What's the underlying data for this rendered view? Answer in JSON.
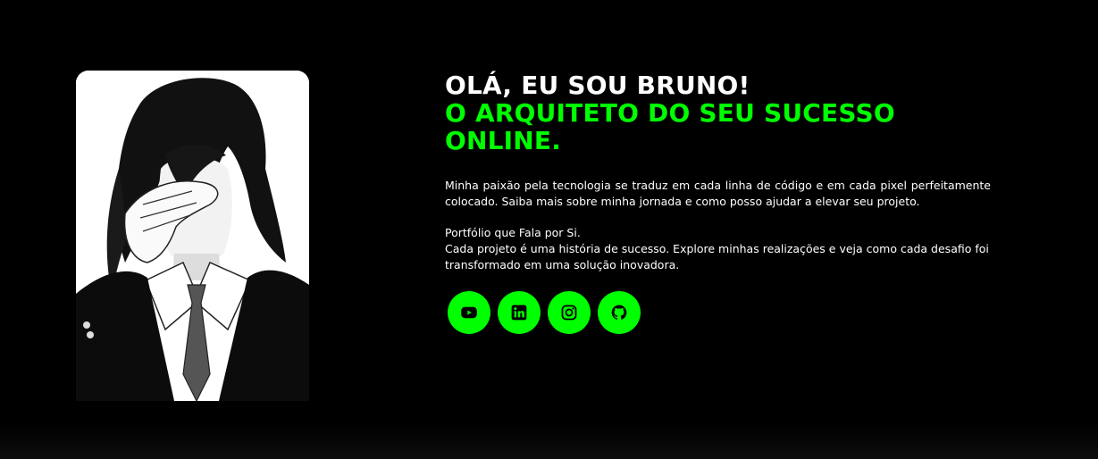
{
  "hero": {
    "headline_white": "OLÁ, EU SOU BRUNO!",
    "headline_green_1": "O ARQUITETO DO SEU SUCESSO",
    "headline_green_2": "ONLINE.",
    "intro": "Minha paixão pela tecnologia se traduz em cada linha de código e em cada pixel perfeitamente colocado. Saiba mais sobre minha jornada e como posso ajudar a elevar seu projeto.",
    "portfolio_title": "Portfólio que Fala por Si.",
    "portfolio_text": "Cada projeto é uma história de sucesso. Explore minhas realizações e veja como cada desafio foi transformado em uma solução inovadora."
  },
  "socials": [
    {
      "icon": "youtube-icon"
    },
    {
      "icon": "linkedin-icon"
    },
    {
      "icon": "instagram-icon"
    },
    {
      "icon": "github-icon"
    }
  ],
  "colors": {
    "background": "#000000",
    "accent": "#00ff00",
    "text": "#ffffff"
  }
}
